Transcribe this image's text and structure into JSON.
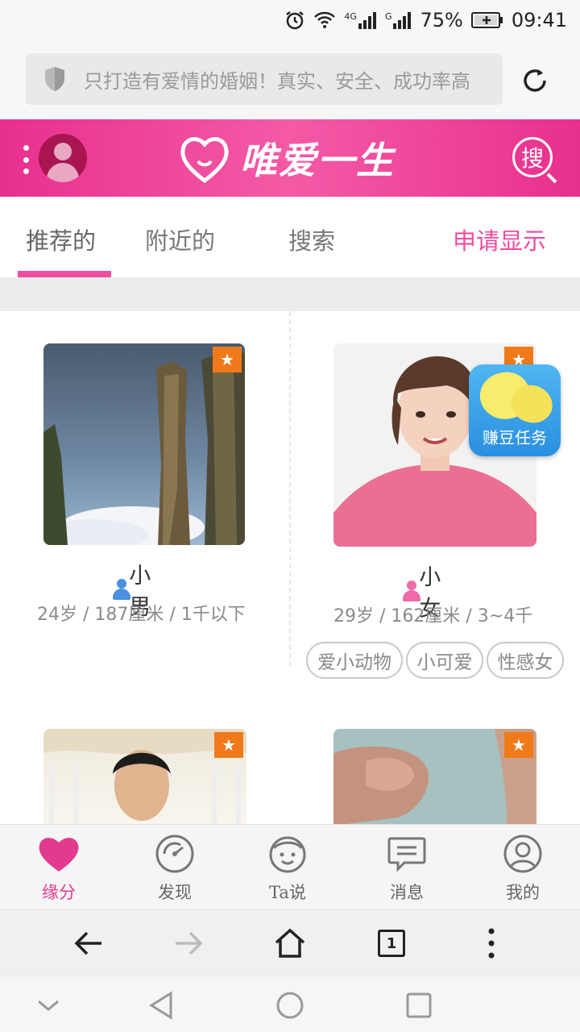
{
  "status_bar": {
    "network1": "4G",
    "network2": "G",
    "battery": "75%",
    "time": "09:41"
  },
  "url_bar": {
    "text": "只打造有爱情的婚姻！真实、安全、成功率高"
  },
  "header": {
    "logo_text": "唯爱一生",
    "search_label": "搜"
  },
  "tabs": [
    {
      "label": "推荐的"
    },
    {
      "label": "附近的"
    },
    {
      "label": "搜索"
    },
    {
      "label": "申请显示"
    }
  ],
  "profiles": [
    {
      "name": "小男",
      "gender": "male",
      "info": "24岁 / 187厘米 / 1千以下",
      "tags": []
    },
    {
      "name": "小女",
      "gender": "female",
      "info": "29岁 / 162厘米 / 3~4千",
      "tags": [
        "爱小动物",
        "小可爱",
        "性感女"
      ]
    },
    {
      "name": "",
      "gender": "male",
      "info": "",
      "tags": []
    },
    {
      "name": "",
      "gender": "",
      "info": "",
      "tags": []
    }
  ],
  "star_glyph": "★",
  "earn_badge": {
    "label": "赚豆任务"
  },
  "app_nav": [
    {
      "label": "缘分",
      "icon": "heart-icon",
      "active": true
    },
    {
      "label": "发现",
      "icon": "compass-icon",
      "active": false
    },
    {
      "label": "Ta说",
      "icon": "face-icon",
      "active": false
    },
    {
      "label": "消息",
      "icon": "message-icon",
      "active": false
    },
    {
      "label": "我的",
      "icon": "profile-icon",
      "active": false
    }
  ],
  "browser_nav": {
    "tab_count": "1"
  },
  "colors": {
    "brand_pink": "#ef4d9d",
    "header_pink": "#e8308d",
    "star_orange": "#f07a19",
    "male_blue": "#4a90e2",
    "female_pink": "#f06aa8"
  }
}
